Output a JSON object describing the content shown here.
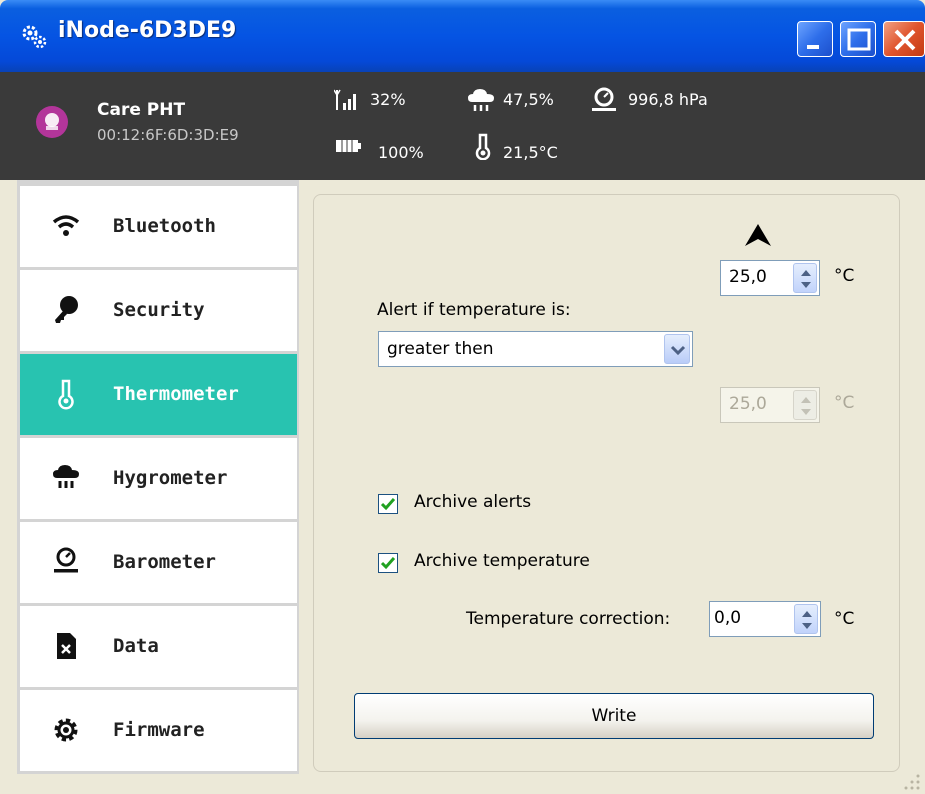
{
  "window": {
    "title": "iNode-6D3DE9",
    "title_icon": "gears-icon"
  },
  "device": {
    "name": "Care PHT",
    "mac": "00:12:6F:6D:3D:E9",
    "signal": "32%",
    "humidity": "47,5%",
    "pressure": "996,8 hPa",
    "battery": "100%",
    "temperature": "21,5°C"
  },
  "sidebar": {
    "items": [
      {
        "label": "Bluetooth",
        "icon": "wifi-icon"
      },
      {
        "label": "Security",
        "icon": "key-icon"
      },
      {
        "label": "Thermometer",
        "icon": "thermometer-icon",
        "active": true
      },
      {
        "label": "Hygrometer",
        "icon": "rain-cloud-icon"
      },
      {
        "label": "Barometer",
        "icon": "barometer-icon"
      },
      {
        "label": "Data",
        "icon": "file-x-icon"
      },
      {
        "label": "Firmware",
        "icon": "gear-icon"
      }
    ]
  },
  "thermometer": {
    "upper_value": "25,0",
    "upper_unit": "°C",
    "alert_label": "Alert if temperature is:",
    "alert_condition": "greater then",
    "lower_value": "25,0",
    "lower_unit": "°C",
    "archive_alerts_label": "Archive alerts",
    "archive_alerts_checked": true,
    "archive_temperature_label": "Archive temperature",
    "archive_temperature_checked": true,
    "correction_label": "Temperature correction:",
    "correction_value": "0,0",
    "correction_unit": "°C",
    "write_label": "Write"
  },
  "colors": {
    "accent": "#28C3B0",
    "header_bg": "#3A3A3A",
    "titlebar": "#0554E3"
  }
}
